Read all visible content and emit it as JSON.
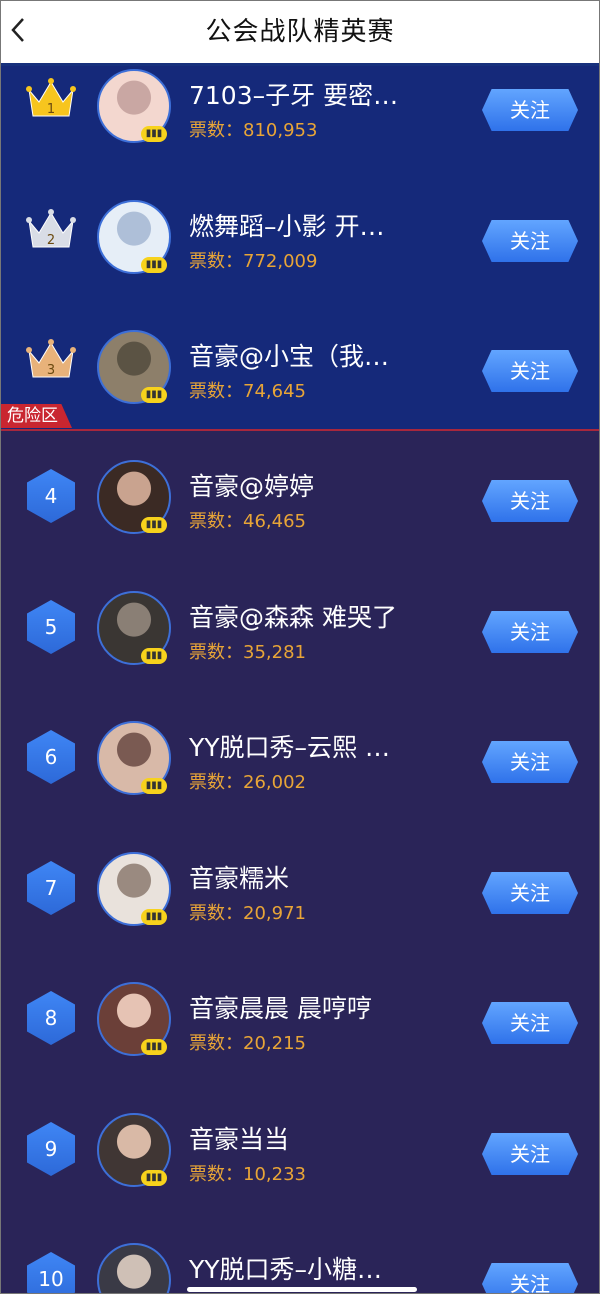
{
  "header": {
    "title": "公会战队精英赛"
  },
  "zones": {
    "danger_label": "危险区"
  },
  "votes_prefix": "票数：",
  "follow_label": "关注",
  "entries": [
    {
      "rank": "1",
      "name": "7103–子牙 要密…",
      "votes": "810,953",
      "badge": "gold"
    },
    {
      "rank": "2",
      "name": "燃舞蹈–小影 开…",
      "votes": "772,009",
      "badge": "silver"
    },
    {
      "rank": "3",
      "name": "音豪@小宝（我…",
      "votes": "74,645",
      "badge": "bronze"
    },
    {
      "rank": "4",
      "name": "音豪@婷婷",
      "votes": "46,465",
      "badge": "hex"
    },
    {
      "rank": "5",
      "name": "音豪@森森 难哭了",
      "votes": "35,281",
      "badge": "hex"
    },
    {
      "rank": "6",
      "name": "YY脱口秀–云熙 …",
      "votes": "26,002",
      "badge": "hex"
    },
    {
      "rank": "7",
      "name": "音豪糯米",
      "votes": "20,971",
      "badge": "hex"
    },
    {
      "rank": "8",
      "name": "音豪晨晨 晨哼哼",
      "votes": "20,215",
      "badge": "hex"
    },
    {
      "rank": "9",
      "name": "音豪当当",
      "votes": "10,233",
      "badge": "hex"
    },
    {
      "rank": "10",
      "name": "YY脱口秀–小糖…",
      "votes": "",
      "badge": "hex"
    }
  ],
  "colors": {
    "top_zone": "#15297a",
    "danger_zone_bg": "#2a2458",
    "votes_text": "#e8a537",
    "follow_button": "#3b82f6",
    "gold": "#f7c51e",
    "silver": "#d9dde6",
    "bronze": "#e8b27a"
  }
}
